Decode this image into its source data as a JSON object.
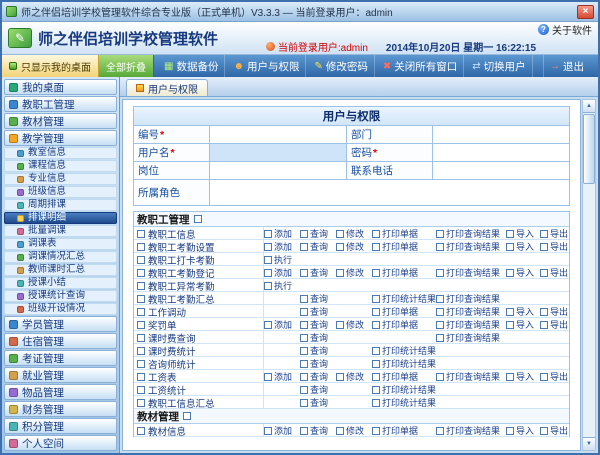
{
  "window": {
    "title": "师之伴侣培训学校管理软件综合专业版（正式单机）V3.3.3 — 当前登录用户：admin",
    "close_glyph": "×"
  },
  "header": {
    "logo_glyph": "✎",
    "app_title": "师之伴侣培训学校管理软件",
    "about_glyph": "?",
    "about": "关于软件",
    "current_user": "当前登录用户:admin",
    "datetime": "2014年10月20日 星期一 16:22:15"
  },
  "toolbar": {
    "left_tabs": [
      {
        "label": "只显示我的桌面"
      },
      {
        "label": "全部折叠"
      }
    ],
    "buttons": [
      {
        "label": "数据备份",
        "icon": "data-backup-icon",
        "glyph": "▦",
        "color": "#aef07a"
      },
      {
        "label": "用户与权限",
        "icon": "users-permissions-icon",
        "glyph": "☻",
        "color": "#ffb347"
      },
      {
        "label": "修改密码",
        "icon": "change-password-icon",
        "glyph": "✎",
        "color": "#ffe14a"
      },
      {
        "label": "关闭所有窗口",
        "icon": "close-all-windows-icon",
        "glyph": "✖",
        "color": "#ff6a5a"
      },
      {
        "label": "切换用户",
        "icon": "switch-user-icon",
        "glyph": "⇄",
        "color": "#bfe0ff"
      },
      {
        "label": "退出",
        "icon": "exit-icon",
        "glyph": "→",
        "color": "#ff8a6a"
      }
    ]
  },
  "sidebar": {
    "items": [
      {
        "type": "top",
        "label": "我的桌面",
        "icon": "desktop-icon",
        "color": "#2aa87a"
      },
      {
        "type": "top",
        "label": "教职工管理",
        "icon": "staff-icon",
        "color": "#3a86d0"
      },
      {
        "type": "top",
        "label": "教材管理",
        "icon": "textbook-icon",
        "color": "#58b04a"
      },
      {
        "type": "top",
        "label": "教学管理",
        "icon": "teaching-folder-icon",
        "color": "#f5a623",
        "expanded": true
      },
      {
        "type": "sub",
        "label": "教室信息",
        "icon": "classroom-icon",
        "color": "#4a9ed4"
      },
      {
        "type": "sub",
        "label": "课程信息",
        "icon": "course-icon",
        "color": "#58b04a"
      },
      {
        "type": "sub",
        "label": "专业信息",
        "icon": "major-icon",
        "color": "#d4a04a"
      },
      {
        "type": "sub",
        "label": "班级信息",
        "icon": "class-icon",
        "color": "#9a6ad4"
      },
      {
        "type": "sub",
        "label": "周期排课",
        "icon": "weekly-schedule-icon",
        "color": "#4ab5b5"
      },
      {
        "type": "sub",
        "label": "排课明细",
        "icon": "schedule-detail-icon",
        "color": "#ffd24a",
        "selected": true
      },
      {
        "type": "sub",
        "label": "批量调课",
        "icon": "batch-adjust-icon",
        "color": "#d46a9a"
      },
      {
        "type": "sub",
        "label": "调课表",
        "icon": "adjust-table-icon",
        "color": "#4a9ed4"
      },
      {
        "type": "sub",
        "label": "调课情况汇总",
        "icon": "adjust-summary-icon",
        "color": "#58b04a"
      },
      {
        "type": "sub",
        "label": "教师课时汇总",
        "icon": "teacher-hours-icon",
        "color": "#d4a04a"
      },
      {
        "type": "sub",
        "label": "授课小结",
        "icon": "lesson-summary-icon",
        "color": "#4ab5b5"
      },
      {
        "type": "sub",
        "label": "授课统计查询",
        "icon": "lesson-stats-icon",
        "color": "#9a6ad4"
      },
      {
        "type": "sub",
        "label": "班级开设情况",
        "icon": "class-open-icon",
        "color": "#d46a4a"
      },
      {
        "type": "top",
        "label": "学员管理",
        "icon": "students-icon",
        "color": "#3a86d0"
      },
      {
        "type": "top",
        "label": "住宿管理",
        "icon": "dorm-icon",
        "color": "#d46a4a"
      },
      {
        "type": "top",
        "label": "考证管理",
        "icon": "certificate-icon",
        "color": "#58b04a"
      },
      {
        "type": "top",
        "label": "就业管理",
        "icon": "employment-icon",
        "color": "#d4a04a"
      },
      {
        "type": "top",
        "label": "物品管理",
        "icon": "goods-icon",
        "color": "#9a6ad4"
      },
      {
        "type": "top",
        "label": "财务管理",
        "icon": "finance-icon",
        "color": "#d4b54a"
      },
      {
        "type": "top",
        "label": "积分管理",
        "icon": "points-icon",
        "color": "#4ab5b5"
      },
      {
        "type": "top",
        "label": "个人空间",
        "icon": "personal-space-icon",
        "color": "#d46a9a"
      }
    ]
  },
  "main": {
    "tab": "用户与权限",
    "form": {
      "title": "用户与权限",
      "required_mark": "*",
      "fields": {
        "id": {
          "label": "编号",
          "value": ""
        },
        "dept": {
          "label": "部门",
          "value": ""
        },
        "username": {
          "label": "用户名",
          "value": ""
        },
        "password": {
          "label": "密码",
          "value": ""
        },
        "position": {
          "label": "岗位",
          "value": ""
        },
        "phone": {
          "label": "联系电话",
          "value": ""
        },
        "role": {
          "label": "所属角色",
          "value": ""
        }
      }
    },
    "permissions": {
      "sections": [
        {
          "title": "教职工管理",
          "rows": [
            {
              "label": "教职工信息",
              "slots": [
                "添加",
                "查询",
                "修改",
                "打印单据",
                "打印查询结果",
                "导入",
                "导出"
              ]
            },
            {
              "label": "教职工考勤设置",
              "slots": [
                "添加",
                "查询",
                "修改",
                "打印单据",
                "打印查询结果",
                "导入",
                "导出"
              ]
            },
            {
              "label": "教职工打卡考勤",
              "slots": [
                "执行",
                null,
                null,
                null,
                null,
                null,
                null
              ]
            },
            {
              "label": "教职工考勤登记",
              "slots": [
                "添加",
                "查询",
                "修改",
                "打印单据",
                "打印查询结果",
                "导入",
                "导出"
              ]
            },
            {
              "label": "教职工异常考勤",
              "slots": [
                "执行",
                null,
                null,
                null,
                null,
                null,
                null
              ]
            },
            {
              "label": "教职工考勤汇总",
              "slots": [
                null,
                "查询",
                null,
                "打印统计结果",
                "打印查询结果",
                null,
                null
              ]
            },
            {
              "label": "工作调动",
              "slots": [
                null,
                "查询",
                null,
                "打印单据",
                "打印查询结果",
                "导入",
                "导出"
              ]
            },
            {
              "label": "奖罚单",
              "slots": [
                "添加",
                "查询",
                "修改",
                "打印单据",
                "打印查询结果",
                "导入",
                "导出"
              ]
            },
            {
              "label": "课时费查询",
              "slots": [
                null,
                "查询",
                null,
                null,
                "打印查询结果",
                null,
                null
              ]
            },
            {
              "label": "课时费统计",
              "slots": [
                null,
                "查询",
                null,
                "打印统计结果",
                null,
                null,
                null
              ]
            },
            {
              "label": "咨询师统计",
              "slots": [
                null,
                "查询",
                null,
                "打印统计结果",
                null,
                null,
                null
              ]
            },
            {
              "label": "工资表",
              "slots": [
                "添加",
                "查询",
                "修改",
                "打印单据",
                "打印查询结果",
                "导入",
                "导出"
              ]
            },
            {
              "label": "工资统计",
              "slots": [
                null,
                "查询",
                null,
                "打印统计结果",
                null,
                null,
                null
              ]
            },
            {
              "label": "教职工信息汇总",
              "slots": [
                null,
                "查询",
                null,
                "打印统计结果",
                null,
                null,
                null
              ]
            }
          ]
        },
        {
          "title": "教材管理",
          "rows": [
            {
              "label": "教材信息",
              "slots": [
                "添加",
                "查询",
                "修改",
                "打印单据",
                "打印查询结果",
                "导入",
                "导出"
              ]
            }
          ]
        }
      ]
    }
  }
}
